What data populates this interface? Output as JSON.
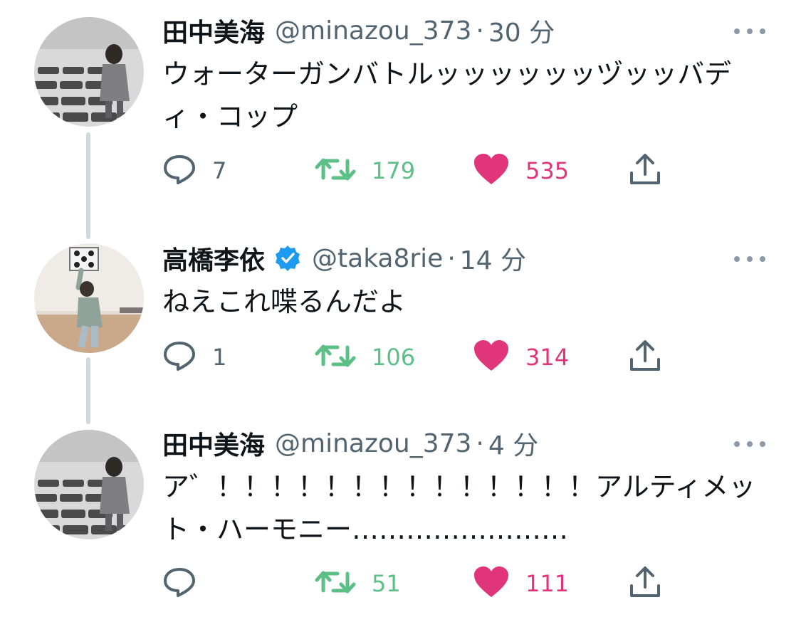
{
  "colors": {
    "retweet_green": "#5bbf86",
    "like_pink": "#e0357a",
    "verified_blue": "#1d9bf0",
    "secondary_text": "#536471",
    "thread_line": "#cfd9de"
  },
  "tweets": [
    {
      "author_name": "田中美海",
      "handle": "@minazou_373",
      "separator": "·",
      "time": "30 分",
      "verified": false,
      "text": "ウォーターガンバトルッッッッッッヅッッバディ・コップ",
      "reply_count": "7",
      "retweet_count": "179",
      "like_count": "535",
      "icons": {
        "more": "more-dots-icon",
        "reply": "reply-bubble-icon",
        "retweet": "retweet-arrows-icon",
        "like": "heart-icon",
        "share": "share-upload-icon"
      }
    },
    {
      "author_name": "高橋李依",
      "handle": "@taka8rie",
      "separator": "·",
      "time": "14 分",
      "verified": true,
      "text": "ねえこれ喋るんだよ",
      "reply_count": "1",
      "retweet_count": "106",
      "like_count": "314",
      "icons": {
        "verified": "verified-badge-icon",
        "more": "more-dots-icon",
        "reply": "reply-bubble-icon",
        "retweet": "retweet-arrows-icon",
        "like": "heart-icon",
        "share": "share-upload-icon"
      }
    },
    {
      "author_name": "田中美海",
      "handle": "@minazou_373",
      "separator": "·",
      "time": "4 分",
      "verified": false,
      "text": "ア゛！！！！！！！！！！！！！！アルティメット・ハーモニー……………………",
      "reply_count": "",
      "retweet_count": "51",
      "like_count": "111",
      "icons": {
        "more": "more-dots-icon",
        "reply": "reply-bubble-icon",
        "retweet": "retweet-arrows-icon",
        "like": "heart-icon",
        "share": "share-upload-icon"
      }
    }
  ]
}
